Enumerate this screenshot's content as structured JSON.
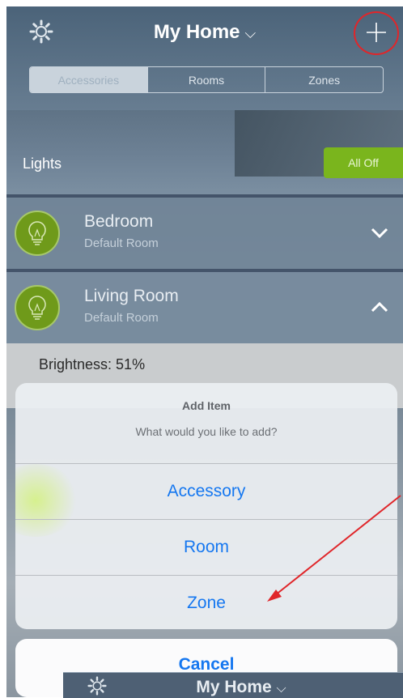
{
  "header": {
    "title": "My Home",
    "title_chevron": "⌵"
  },
  "segments": [
    "Accessories",
    "Rooms",
    "Zones"
  ],
  "lights": {
    "label": "Lights",
    "all_off": "All Off"
  },
  "rooms": [
    {
      "name": "Bedroom",
      "sub": "Default Room",
      "expanded": false
    },
    {
      "name": "Living Room",
      "sub": "Default Room",
      "expanded": true
    }
  ],
  "brightness": {
    "label": "Brightness: 51%",
    "value": 51
  },
  "action_sheet": {
    "title": "Add Item",
    "message": "What would you like to add?",
    "options": [
      "Accessory",
      "Room",
      "Zone"
    ],
    "cancel": "Cancel"
  },
  "overlay_screenshot": {
    "title": "My Home",
    "title_chevron": "⌵"
  },
  "colors": {
    "accent": "#1577f0",
    "annotation": "#e0262a",
    "green": "#7ab51d"
  }
}
